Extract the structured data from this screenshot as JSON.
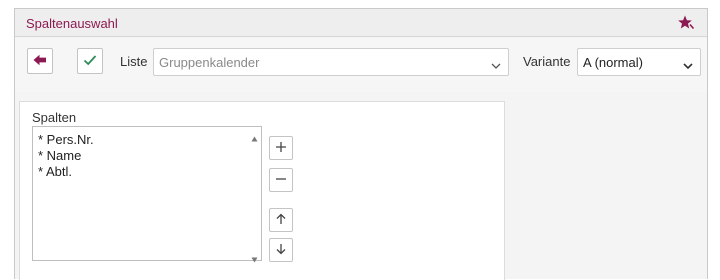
{
  "window": {
    "title": "Spaltenauswahl"
  },
  "toolbar": {
    "liste_label": "Liste",
    "liste_value": "Gruppenkalender",
    "variante_label": "Variante",
    "variante_value": "A (normal)"
  },
  "columns_panel": {
    "label": "Spalten",
    "items": [
      "* Pers.Nr.",
      "* Name",
      "* Abtl."
    ]
  },
  "icons": {
    "pin": "pin-star-icon",
    "back": "arrow-left-icon",
    "confirm": "checkmark-icon",
    "add": "plus-icon",
    "remove": "minus-icon",
    "up": "arrow-up-icon",
    "down": "arrow-down-icon"
  },
  "colors": {
    "accent": "#8c1a52",
    "confirm": "#2e8b57"
  }
}
